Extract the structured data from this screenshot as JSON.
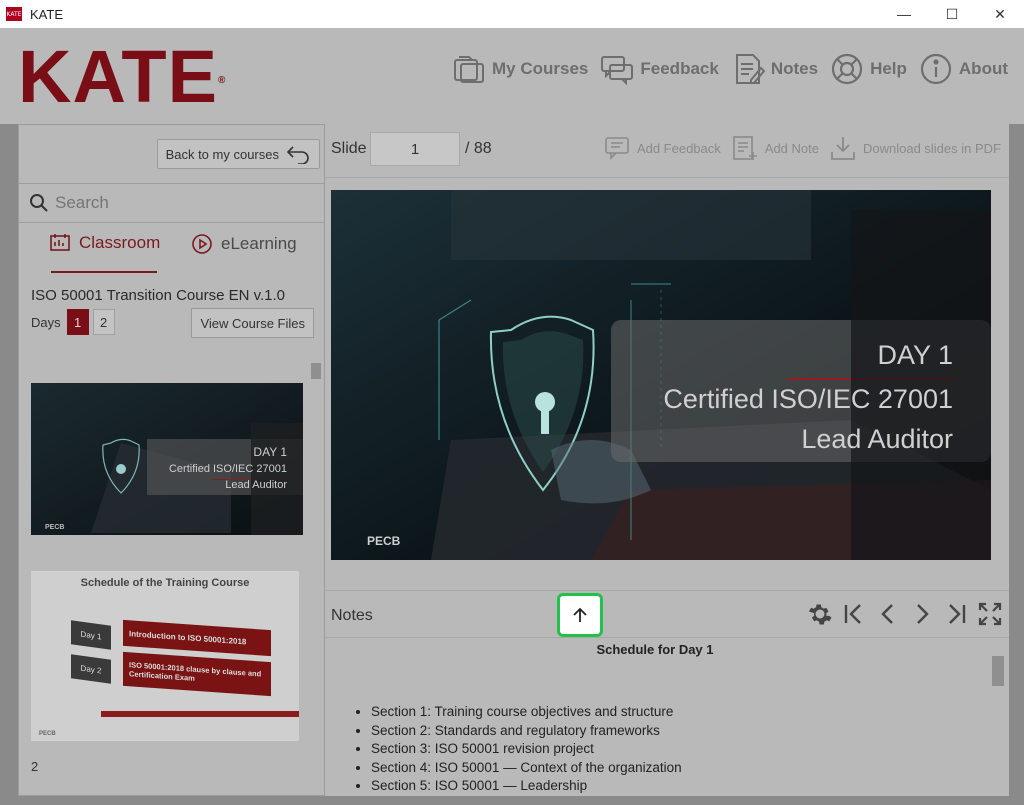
{
  "window": {
    "app_icon_text": "KATE",
    "title": "KATE",
    "controls": {
      "minimize": "—",
      "maximize": "☐",
      "close": "✕"
    }
  },
  "header": {
    "logo": "KATE",
    "logo_mark": "®",
    "nav": [
      {
        "label": "My Courses",
        "icon": "folder-icon"
      },
      {
        "label": "Feedback",
        "icon": "chat-icon"
      },
      {
        "label": "Notes",
        "icon": "notes-icon"
      },
      {
        "label": "Help",
        "icon": "lifebuoy-icon"
      },
      {
        "label": "About",
        "icon": "info-icon"
      }
    ]
  },
  "sidebar": {
    "back_label": "Back to my courses",
    "search_placeholder": "Search",
    "tabs": [
      {
        "label": "Classroom",
        "active": true,
        "icon": "classroom-icon"
      },
      {
        "label": "eLearning",
        "active": false,
        "icon": "play-icon"
      }
    ],
    "course_title": "ISO 50001 Transition Course  EN v.1.0",
    "days_label": "Days",
    "days": [
      "1",
      "2"
    ],
    "active_day": "1",
    "view_files_label": "View Course Files",
    "thumbnails": [
      {
        "day": "DAY 1",
        "title": "Certified ISO/IEC 27001",
        "subtitle": "Lead Auditor",
        "brand": "PECB"
      },
      {
        "heading": "Schedule of the Training Course",
        "rows": [
          {
            "day": "Day 1",
            "text": "Introduction to ISO 50001:2018"
          },
          {
            "day": "Day 2",
            "text": "ISO 50001:2018 clause by clause and Certification Exam"
          }
        ],
        "brand": "PECB"
      }
    ],
    "next_index": "2"
  },
  "slide": {
    "label": "Slide",
    "current": "1",
    "total": "/ 88",
    "actions": [
      {
        "label": "Add Feedback",
        "icon": "feedback-icon"
      },
      {
        "label": "Add Note",
        "icon": "add-note-icon"
      },
      {
        "label": "Download slides in PDF",
        "icon": "download-icon"
      }
    ],
    "content": {
      "day": "DAY 1",
      "title": "Certified ISO/IEC 27001",
      "subtitle": "Lead Auditor",
      "brand": "PECB"
    }
  },
  "notes": {
    "label": "Notes",
    "toggle_icon": "arrow-up-icon",
    "title": "Schedule for Day 1",
    "items": [
      "Section 1: Training course objectives and structure",
      "Section 2: Standards and regulatory frameworks",
      "Section 3: ISO 50001 revision project",
      "Section 4: ISO 50001 — Context of the organization",
      "Section 5: ISO 50001 — Leadership"
    ]
  },
  "colors": {
    "brand": "#7a0e17",
    "highlight": "#22c24a"
  }
}
